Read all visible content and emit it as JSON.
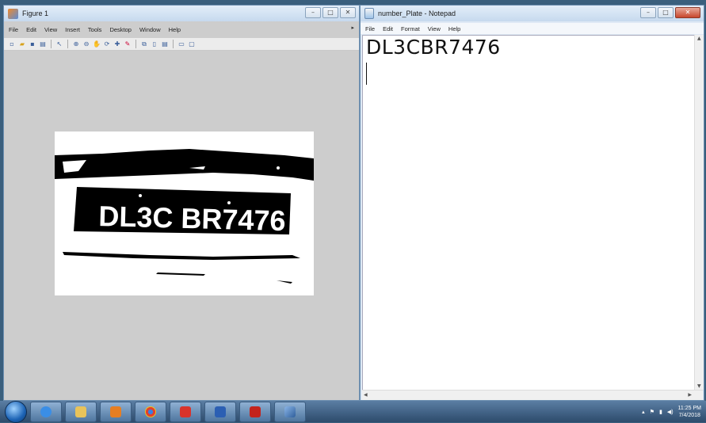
{
  "figure_window": {
    "title": "Figure 1",
    "menu": [
      "File",
      "Edit",
      "View",
      "Insert",
      "Tools",
      "Desktop",
      "Window",
      "Help"
    ],
    "plate_image": {
      "plate_text": "DL3C BR7476"
    }
  },
  "notepad_window": {
    "title": "number_Plate - Notepad",
    "menu": [
      "File",
      "Edit",
      "Format",
      "View",
      "Help"
    ],
    "content": "DL3CBR7476"
  },
  "taskbar": {
    "clock_time": "11:25 PM",
    "clock_date": "7/4/2018"
  },
  "colors": {
    "figure_bg": "#cdcdcd",
    "notepad_bg": "#ffffff",
    "taskbar": "#2d4b6c",
    "plate_black": "#000000"
  }
}
